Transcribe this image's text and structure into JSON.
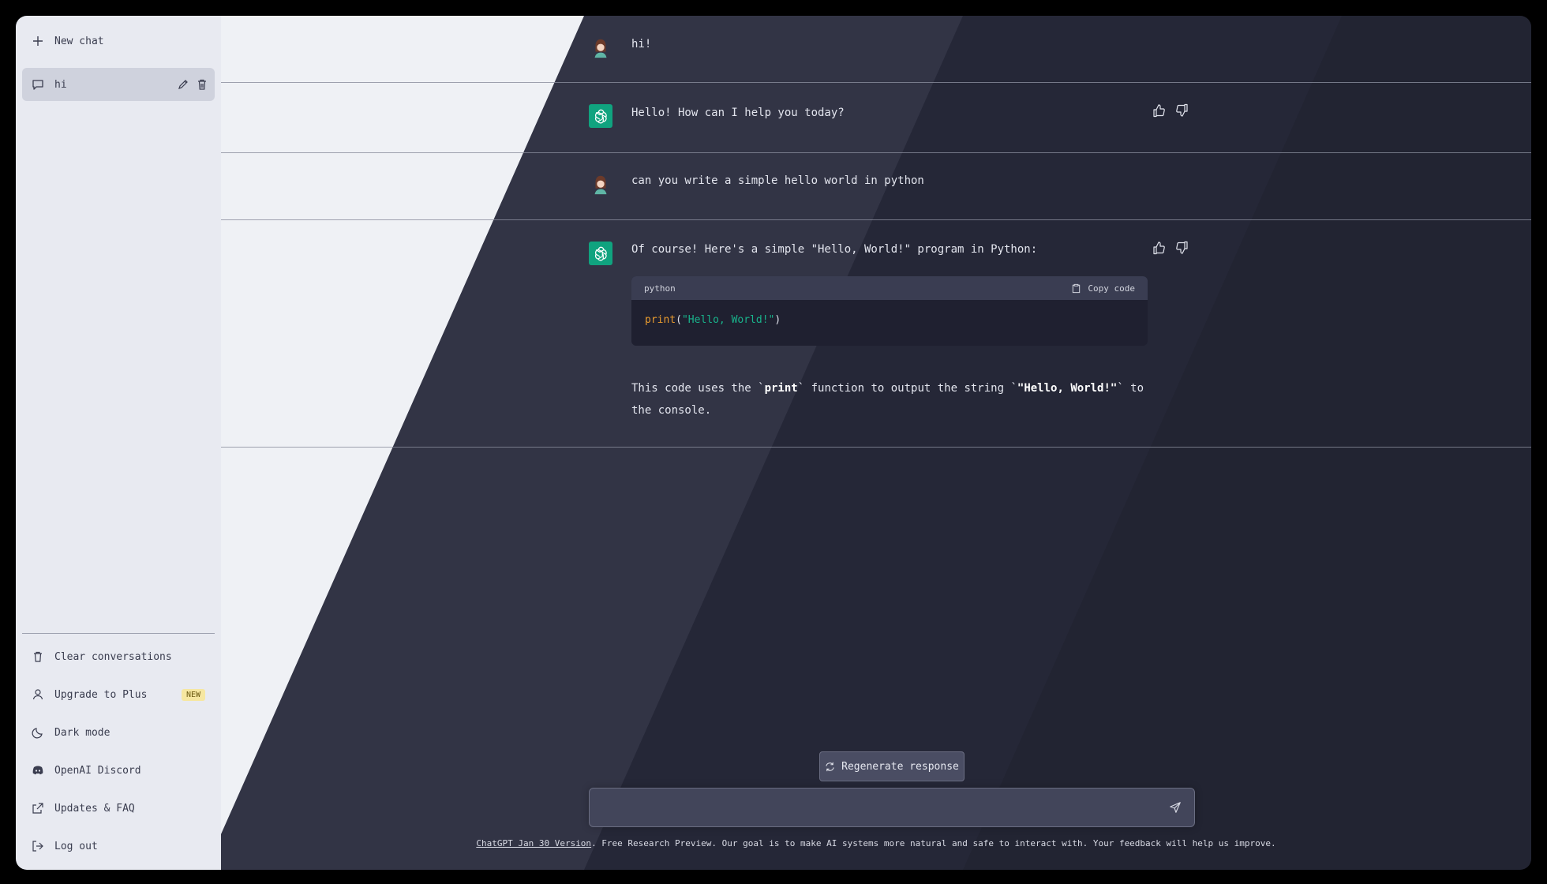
{
  "sidebar": {
    "new_chat": "New chat",
    "conversations": [
      {
        "title": "hi"
      }
    ],
    "bottom": {
      "clear": "Clear conversations",
      "upgrade": "Upgrade to Plus",
      "upgrade_badge": "NEW",
      "dark_mode": "Dark mode",
      "discord": "OpenAI Discord",
      "updates": "Updates & FAQ",
      "logout": "Log out"
    }
  },
  "messages": [
    {
      "role": "user",
      "text": "hi!"
    },
    {
      "role": "assistant",
      "text": "Hello! How can I help you today?"
    },
    {
      "role": "user",
      "text": "can you write a simple hello world in python"
    },
    {
      "role": "assistant",
      "intro": "Of course! Here's a simple \"Hello, World!\" program in Python:",
      "code": {
        "language": "python",
        "copy_label": "Copy code",
        "fn": "print",
        "open": "(",
        "str": "\"Hello, World!\"",
        "close": ")"
      },
      "outro_1": "This code uses the `",
      "outro_code_1": "print",
      "outro_2": "` function to output the string `",
      "outro_code_2": "\"Hello, World!\"",
      "outro_3": "` to the console."
    }
  ],
  "composer": {
    "regenerate": "Regenerate response",
    "placeholder": ""
  },
  "footer": {
    "version_link": "ChatGPT Jan 30 Version",
    "text": ". Free Research Preview. Our goal is to make AI systems more natural and safe to interact with. Your feedback will help us improve."
  },
  "colors": {
    "bot_avatar": "#10a37f",
    "sidebar_bg": "#e8eaf1",
    "main_bg": "#2b2d3f",
    "badge_bg": "#f6e7a1"
  }
}
